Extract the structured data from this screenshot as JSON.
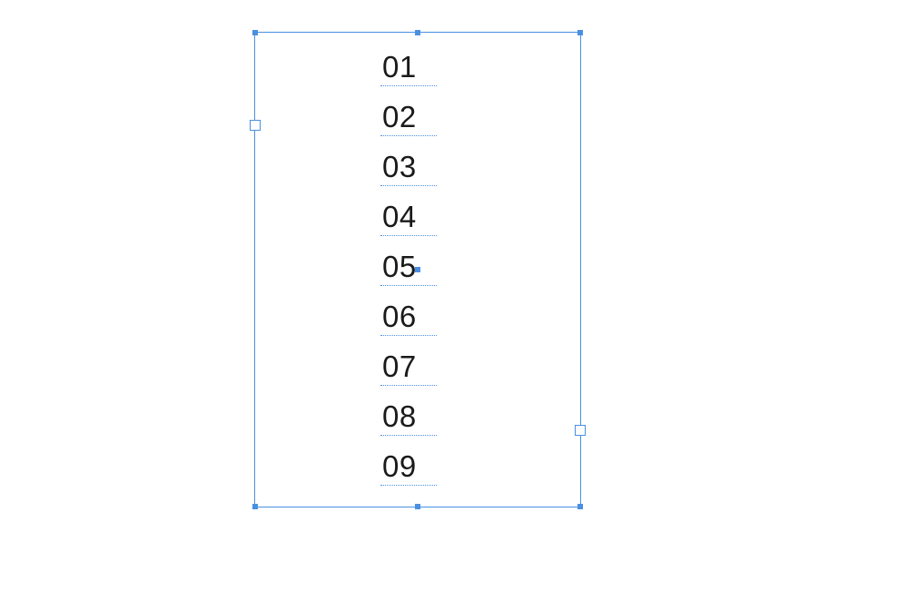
{
  "textFrame": {
    "lines": [
      "01",
      "02",
      "03",
      "04",
      "05",
      "06",
      "07",
      "08",
      "09"
    ]
  }
}
